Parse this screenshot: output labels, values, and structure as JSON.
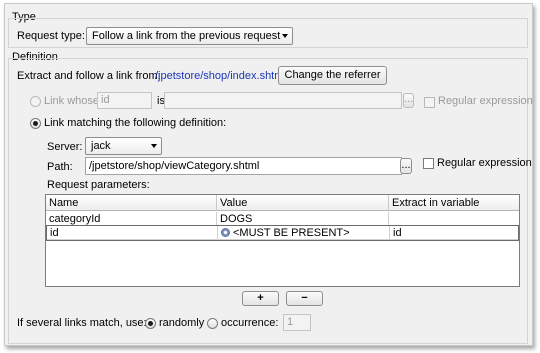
{
  "type_section": {
    "title": "Type",
    "request_type_label": "Request type:",
    "request_type_value": "Follow a link from the previous request"
  },
  "definition_section": {
    "title": "Definition",
    "extract_label": "Extract and follow a link from:",
    "extract_url": "/jpetstore/shop/index.shtml",
    "change_referrer_label": "Change the referrer"
  },
  "link_whose": {
    "label": "Link whose",
    "attribute_value": "id",
    "is_label": "is",
    "value": "",
    "browse_label": "...",
    "regex_label": "Regular expression"
  },
  "link_matching": {
    "label": "Link matching the following definition:",
    "server_label": "Server:",
    "server_value": "jack",
    "path_label": "Path:",
    "path_value": "/jpetstore/shop/viewCategory.shtml",
    "browse_label": "...",
    "regex_label": "Regular expression",
    "params_label": "Request parameters:"
  },
  "params_table": {
    "columns": [
      "Name",
      "Value",
      "Extract in variable"
    ],
    "rows": [
      {
        "name": "categoryId",
        "value": "DOGS",
        "variable": ""
      },
      {
        "name": "id",
        "value": "<MUST BE PRESENT>",
        "variable": "id",
        "value_icon": "gear-icon"
      }
    ]
  },
  "table_buttons": {
    "add": "+",
    "remove": "−"
  },
  "footer": {
    "several_label": "If several links match, use:",
    "randomly_label": "randomly",
    "occurrence_label": "occurrence:",
    "occurrence_value": "1"
  }
}
